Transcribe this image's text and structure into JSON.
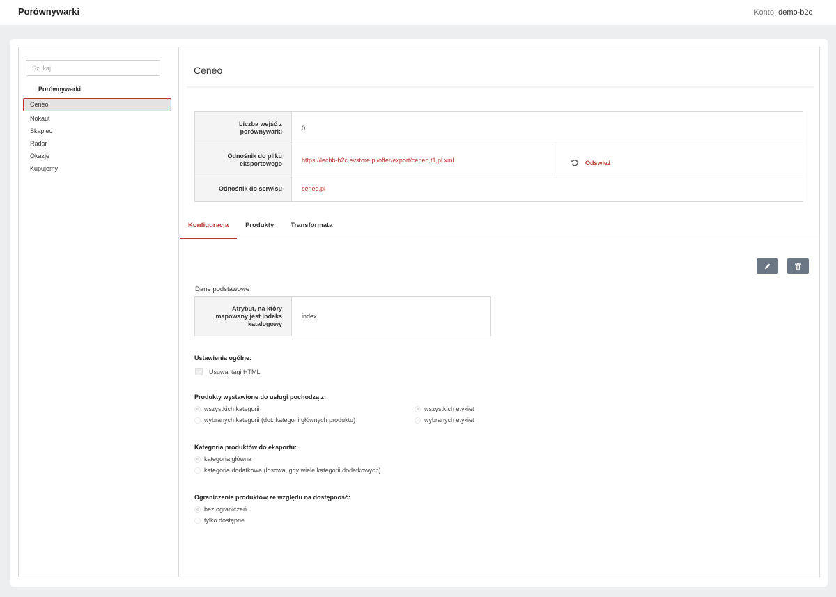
{
  "app": {
    "title": "Porównywarki",
    "account_label": "Konto:",
    "account_name": "demo-b2c"
  },
  "sidebar": {
    "search_placeholder": "Szukaj",
    "heading": "Porównywarki",
    "items": [
      {
        "label": "Ceneo",
        "active": true
      },
      {
        "label": "Nokaut"
      },
      {
        "label": "Skąpiec"
      },
      {
        "label": "Radar"
      },
      {
        "label": "Okazje"
      },
      {
        "label": "Kupujemy"
      }
    ]
  },
  "main": {
    "title": "Ceneo",
    "info": {
      "visits_label": "Liczba wejść z porównywarki",
      "visits_value": "0",
      "export_label": "Odnośnik do pliku eksportowego",
      "export_link": "https://lechb-b2c.evstore.pl/offer/export/ceneo,t1,pl.xml",
      "refresh_label": "Odśwież",
      "service_label": "Odnośnik do serwisu",
      "service_link": "ceneo.pl"
    },
    "tabs": [
      {
        "label": "Konfiguracja",
        "active": true
      },
      {
        "label": "Produkty"
      },
      {
        "label": "Transformata"
      }
    ],
    "actions": {
      "edit_icon": "pencil-icon",
      "delete_icon": "trash-icon"
    },
    "basic": {
      "title": "Dane podstawowe",
      "attr_label": "Atrybut, na który mapowany jest indeks katalogowy",
      "attr_value": "index"
    },
    "general": {
      "title": "Ustawienia ogólne:",
      "strip_html_label": "Usuwaj tagi HTML",
      "strip_html_checked": true
    },
    "products_source": {
      "title": "Produkty wystawione do usługi pochodzą z:",
      "categories": [
        "wszystkich kategorii",
        "wybranych kategorii (dot. kategorii głównych produktu)"
      ],
      "labels": [
        "wszystkich etykiet",
        "wybranych etykiet"
      ]
    },
    "category_export": {
      "title": "Kategoria produktów do eksportu:",
      "options": [
        "kategoria główna",
        "kategoria dodatkowa (losowa, gdy wiele kategorii dodatkowych)"
      ]
    },
    "availability": {
      "title": "Ograniczenie produktów ze względu na dostępność:",
      "options": [
        "bez ograniczeń",
        "tylko dostępne"
      ]
    }
  },
  "colors": {
    "accent": "#b9342e",
    "button": "#6b7784",
    "background": "#eceef0"
  }
}
